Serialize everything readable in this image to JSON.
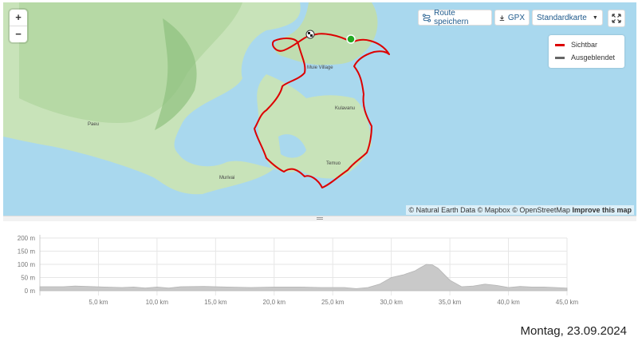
{
  "toolbar": {
    "zoom_in": "+",
    "zoom_out": "−",
    "save_route": "Route speichern",
    "gpx": "GPX",
    "map_style": "Standardkarte"
  },
  "legend": {
    "visible": "Sichtbar",
    "hidden": "Ausgeblendet",
    "visible_color": "#dd0000",
    "hidden_color": "#666666"
  },
  "places": {
    "muie": "Muie Village",
    "kulavanu": "Kulavanu",
    "paeu": "Paeu",
    "temuo": "Temuo",
    "murivai": "Murivai"
  },
  "attribution": {
    "text": "© Natural Earth Data © Mapbox © OpenStreetMap",
    "improve": "Improve this map"
  },
  "chart_data": {
    "type": "area",
    "xlabel": "",
    "ylabel": "",
    "x_ticks": [
      "5,0 km",
      "10,0 km",
      "15,0 km",
      "20,0 km",
      "25,0 km",
      "30,0 km",
      "35,0 km",
      "40,0 km",
      "45,0 km"
    ],
    "y_ticks": [
      "200 m",
      "150 m",
      "100 m",
      "50 m",
      "0 m"
    ],
    "xlim": [
      0,
      45
    ],
    "ylim": [
      0,
      200
    ],
    "grid": true,
    "x": [
      0,
      2,
      3,
      4,
      7,
      8,
      9,
      10,
      11,
      12,
      14,
      16,
      18,
      20,
      22,
      24,
      26,
      27,
      28,
      29,
      30,
      31,
      32,
      32.5,
      33,
      33.5,
      34,
      35,
      36,
      37,
      38,
      39,
      40,
      41,
      42,
      43,
      44,
      45
    ],
    "y": [
      15,
      15,
      18,
      16,
      12,
      14,
      10,
      14,
      10,
      15,
      16,
      14,
      12,
      14,
      14,
      12,
      12,
      8,
      12,
      25,
      50,
      60,
      75,
      88,
      100,
      98,
      85,
      40,
      15,
      18,
      25,
      20,
      12,
      16,
      14,
      14,
      12,
      10
    ]
  },
  "date": "Montag, 23.09.2024"
}
